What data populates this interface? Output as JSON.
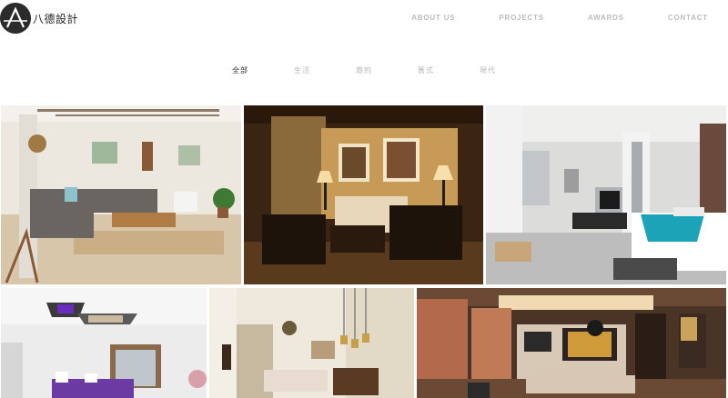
{
  "brand": {
    "name": "八德設計",
    "logo_letter": "A"
  },
  "nav": {
    "items": [
      {
        "label": "ABOUT US"
      },
      {
        "label": "PROJECTS"
      },
      {
        "label": "AWARDS"
      },
      {
        "label": "CONTACT"
      }
    ]
  },
  "filters": {
    "items": [
      {
        "label": "全部",
        "active": true
      },
      {
        "label": "生活",
        "active": false
      },
      {
        "label": "簡約",
        "active": false
      },
      {
        "label": "舊式",
        "active": false
      },
      {
        "label": "現代",
        "active": false
      }
    ]
  },
  "gallery": {
    "count": 6
  }
}
